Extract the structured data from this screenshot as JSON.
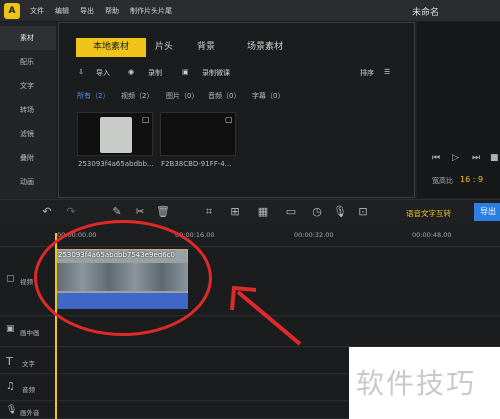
{
  "app": {
    "logo_text": "A",
    "menu": [
      "文件",
      "编辑",
      "导出",
      "帮助",
      "制作片头片尾"
    ],
    "window_title": "未命名"
  },
  "leftnav": {
    "items": [
      "素材",
      "配乐",
      "文字",
      "转场",
      "滤镜",
      "叠附",
      "动画"
    ],
    "active_index": 0
  },
  "media": {
    "tabs": [
      "本地素材",
      "片头",
      "背景",
      "场景素材"
    ],
    "tools": {
      "import": "导入",
      "record": "录制",
      "record_lecture": "录制微课",
      "sort": "排序"
    },
    "filters": [
      "所有（2）",
      "视频（2）",
      "图片（0）",
      "音频（0）",
      "字幕（0）"
    ],
    "thumbnails": [
      {
        "name": "253093f4a65abdbb..."
      },
      {
        "name": "F2B38CBD-91FF-4..."
      }
    ]
  },
  "preview": {
    "aspect_label": "宽高比",
    "aspect_value": "16 : 9"
  },
  "toolbar": {
    "speech_to_text": "语音文字互转",
    "export": "导出"
  },
  "timeline": {
    "ticks": [
      "00:00:00.00",
      "00:00:16.00",
      "00:00:32.00",
      "00:00:48.00"
    ],
    "tracks": [
      "视频",
      "画中画",
      "文字",
      "音频",
      "画外音"
    ],
    "clip_title": "253093f4a65abdbb7543e9ed6c0"
  },
  "watermark": {
    "text": "软件技巧"
  },
  "colors": {
    "accent": "#f0c419",
    "annotation": "#e02a2a",
    "audio_wave": "#3f67c9"
  }
}
